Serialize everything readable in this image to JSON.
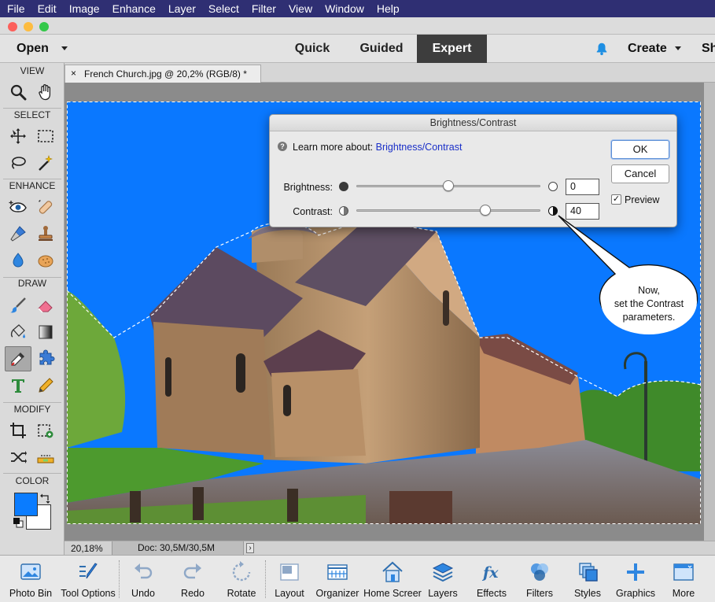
{
  "menubar": {
    "items": [
      "File",
      "Edit",
      "Image",
      "Enhance",
      "Layer",
      "Select",
      "Filter",
      "View",
      "Window",
      "Help"
    ]
  },
  "header": {
    "open_label": "Open",
    "modes": [
      "Quick",
      "Guided",
      "Expert"
    ],
    "active_mode": "Expert",
    "create_label": "Create",
    "share_label": "Sh"
  },
  "tools": {
    "sections": [
      "VIEW",
      "SELECT",
      "ENHANCE",
      "DRAW",
      "MODIFY",
      "COLOR"
    ],
    "foreground_color": "#0a7cff",
    "background_color": "#ffffff"
  },
  "document": {
    "tab_title": "French Church.jpg @ 20,2% (RGB/8) *",
    "tab_close": "×",
    "zoom": "20,18%",
    "doc_info": "Doc: 30,5M/30,5M",
    "status_arrow": "›"
  },
  "dialog": {
    "title": "Brightness/Contrast",
    "help_icon": "?",
    "learn_prefix": "Learn more about:",
    "learn_link": "Brightness/Contrast",
    "brightness_label": "Brightness:",
    "brightness_value": "0",
    "brightness_fraction": 0.5,
    "contrast_label": "Contrast:",
    "contrast_value": "40",
    "contrast_fraction": 0.7,
    "ok_label": "OK",
    "cancel_label": "Cancel",
    "preview_label": "Preview",
    "preview_checked": "✓"
  },
  "callout": {
    "line1": "Now,",
    "line2": "set the Contrast",
    "line3": "parameters."
  },
  "taskbar": {
    "items": [
      "Photo Bin",
      "Tool Options",
      "Undo",
      "Redo",
      "Rotate",
      "Layout",
      "Organizer",
      "Home Screer",
      "Layers",
      "Effects",
      "Filters",
      "Styles",
      "Graphics",
      "More"
    ]
  },
  "colors": {
    "menubar_bg": "#2f2f73",
    "accent_blue": "#1e8fe3",
    "sky_blue": "#0a78ff"
  }
}
